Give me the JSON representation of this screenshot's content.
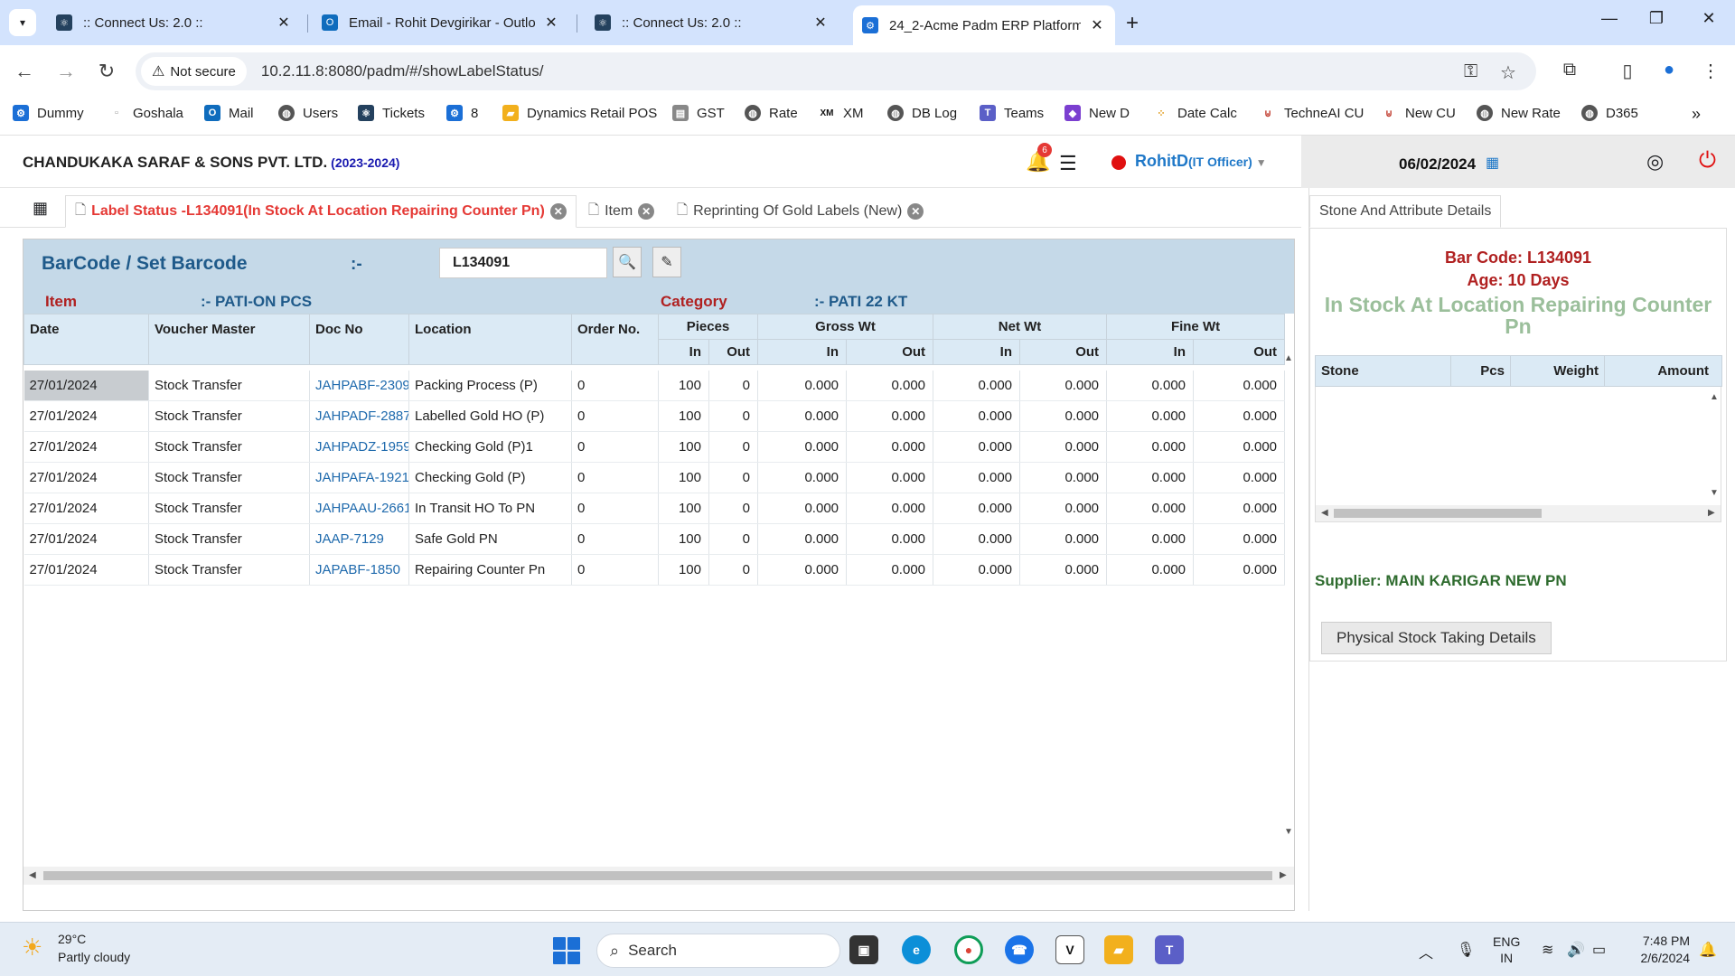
{
  "browser": {
    "tabs": [
      {
        "title": ":: Connect Us: 2.0 ::",
        "active": false
      },
      {
        "title": "Email - Rohit Devgirikar - Outlo",
        "active": false
      },
      {
        "title": ":: Connect Us: 2.0 ::",
        "active": false
      },
      {
        "title": "24_2-Acme Padm ERP Platform",
        "active": true
      }
    ],
    "security_label": "Not secure",
    "url": "10.2.11.8:8080/padm/#/showLabelStatus/",
    "bookmarks": [
      "Dummy",
      "Goshala",
      "Mail",
      "Users",
      "Tickets",
      "8",
      "Dynamics Retail POS",
      "GST",
      "Rate",
      "XM",
      "DB Log",
      "Teams",
      "New D",
      "Date Calc",
      "TechneAI CU",
      "New CU",
      "New Rate",
      "D365"
    ]
  },
  "header": {
    "company": "CHANDUKAKA SARAF & SONS PVT. LTD.",
    "year": "(2023-2024)",
    "notification_count": "6",
    "user_name": "RohitD",
    "user_role": "(IT Officer)",
    "date": "06/02/2024"
  },
  "app_tabs": [
    {
      "label": "Label Status -L134091(In Stock At Location Repairing Counter Pn)",
      "active": true
    },
    {
      "label": "Item",
      "active": false
    },
    {
      "label": "Reprinting Of Gold Labels (New)",
      "active": false
    }
  ],
  "search": {
    "label": "BarCode / Set Barcode",
    "colon": ":-",
    "value": "L134091"
  },
  "info": {
    "item_label": "Item",
    "item_value": ":- PATI-ON PCS",
    "category_label": "Category",
    "category_value": ":- PATI 22 KT"
  },
  "grid": {
    "headers": {
      "date": "Date",
      "voucher": "Voucher Master",
      "doc": "Doc No",
      "location": "Location",
      "order": "Order No.",
      "pieces": "Pieces",
      "gross": "Gross Wt",
      "net": "Net Wt",
      "fine": "Fine Wt",
      "in": "In",
      "out": "Out"
    },
    "rows": [
      {
        "date": "27/01/2024",
        "voucher": "Stock Transfer",
        "doc": "JAHPABF-2309",
        "location": "Packing Process (P)",
        "order": "0",
        "pcs_in": "100",
        "pcs_out": "0",
        "gross_in": "0.000",
        "gross_out": "0.000",
        "net_in": "0.000",
        "net_out": "0.000",
        "fine_in": "0.000",
        "fine_out": "0.000"
      },
      {
        "date": "27/01/2024",
        "voucher": "Stock Transfer",
        "doc": "JAHPADF-2887",
        "location": "Labelled Gold HO (P)",
        "order": "0",
        "pcs_in": "100",
        "pcs_out": "0",
        "gross_in": "0.000",
        "gross_out": "0.000",
        "net_in": "0.000",
        "net_out": "0.000",
        "fine_in": "0.000",
        "fine_out": "0.000"
      },
      {
        "date": "27/01/2024",
        "voucher": "Stock Transfer",
        "doc": "JAHPADZ-1959",
        "location": "Checking Gold (P)1",
        "order": "0",
        "pcs_in": "100",
        "pcs_out": "0",
        "gross_in": "0.000",
        "gross_out": "0.000",
        "net_in": "0.000",
        "net_out": "0.000",
        "fine_in": "0.000",
        "fine_out": "0.000"
      },
      {
        "date": "27/01/2024",
        "voucher": "Stock Transfer",
        "doc": "JAHPAFA-1921",
        "location": "Checking Gold (P)",
        "order": "0",
        "pcs_in": "100",
        "pcs_out": "0",
        "gross_in": "0.000",
        "gross_out": "0.000",
        "net_in": "0.000",
        "net_out": "0.000",
        "fine_in": "0.000",
        "fine_out": "0.000"
      },
      {
        "date": "27/01/2024",
        "voucher": "Stock Transfer",
        "doc": "JAHPAAU-2661",
        "location": "In Transit HO To PN",
        "order": "0",
        "pcs_in": "100",
        "pcs_out": "0",
        "gross_in": "0.000",
        "gross_out": "0.000",
        "net_in": "0.000",
        "net_out": "0.000",
        "fine_in": "0.000",
        "fine_out": "0.000"
      },
      {
        "date": "27/01/2024",
        "voucher": "Stock Transfer",
        "doc": "JAAP-7129",
        "location": "Safe Gold PN",
        "order": "0",
        "pcs_in": "100",
        "pcs_out": "0",
        "gross_in": "0.000",
        "gross_out": "0.000",
        "net_in": "0.000",
        "net_out": "0.000",
        "fine_in": "0.000",
        "fine_out": "0.000"
      },
      {
        "date": "27/01/2024",
        "voucher": "Stock Transfer",
        "doc": "JAPABF-1850",
        "location": "Repairing Counter Pn",
        "order": "0",
        "pcs_in": "100",
        "pcs_out": "0",
        "gross_in": "0.000",
        "gross_out": "0.000",
        "net_in": "0.000",
        "net_out": "0.000",
        "fine_in": "0.000",
        "fine_out": "0.000"
      }
    ]
  },
  "right_panel": {
    "tab": "Stone And Attribute Details",
    "barcode": "Bar Code: L134091",
    "age": "Age: 10 Days",
    "status": "In Stock At Location Repairing Counter Pn",
    "stone_headers": {
      "stone": "Stone",
      "pcs": "Pcs",
      "weight": "Weight",
      "amount": "Amount"
    },
    "supplier": "Supplier: MAIN KARIGAR NEW PN",
    "physical_button": "Physical Stock Taking Details"
  },
  "taskbar": {
    "temp": "29°C",
    "weather": "Partly cloudy",
    "search": "Search",
    "lang1": "ENG",
    "lang2": "IN",
    "time": "7:48 PM",
    "date": "2/6/2024"
  },
  "colors": {
    "accent_blue": "#1f78c8",
    "active_tab_red": "#e53935",
    "label_red": "#b02020",
    "panel_blue": "#c5d9e8"
  }
}
